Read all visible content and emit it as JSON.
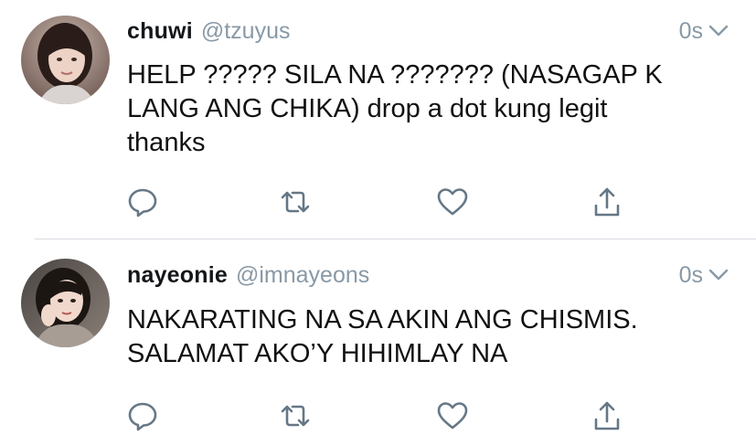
{
  "colors": {
    "name_text": "#14171a",
    "muted_text": "#8899a6",
    "body_text": "#111111",
    "icon_stroke": "#657786",
    "divider": "#d8dde1"
  },
  "tweets": [
    {
      "display_name": "chuwi",
      "handle": "@tzuyus",
      "timestamp": "0s",
      "body": "HELP ?????  SILA NA ??????? (NASAGAP K\nLANG ANG CHIKA) drop a dot kung legit\nthanks",
      "avatar_icon": "avatar-photo",
      "menu_icon": "chevron-down-icon",
      "action_icons": [
        "reply-icon",
        "retweet-icon",
        "like-icon",
        "share-icon"
      ]
    },
    {
      "display_name": "nayeonie",
      "handle": "@imnayeons",
      "timestamp": "0s",
      "body": "NAKARATING NA SA AKIN ANG CHISMIS.\nSALAMAT AKO’Y HIHIMLAY NA",
      "avatar_icon": "avatar-photo",
      "menu_icon": "chevron-down-icon",
      "action_icons": [
        "reply-icon",
        "retweet-icon",
        "like-icon",
        "share-icon"
      ]
    }
  ]
}
